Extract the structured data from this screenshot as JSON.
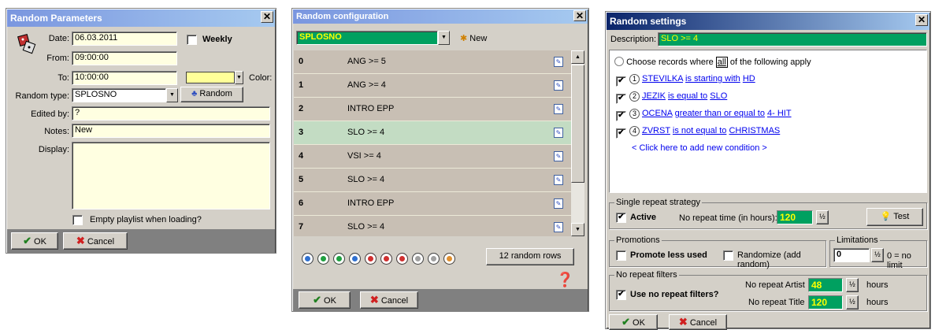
{
  "win1": {
    "title": "Random Parameters",
    "date_label": "Date:",
    "date_value": "06.03.2011",
    "weekly_label": "Weekly",
    "from_label": "From:",
    "from_value": "09:00:00",
    "to_label": "To:",
    "to_value": "10:00:00",
    "color_label": "Color:",
    "color_value": "#ffff99",
    "random_type_label": "Random type:",
    "random_type_value": "SPLOSNO",
    "random_button": "Random",
    "edited_by_label": "Edited by:",
    "edited_by_value": "?",
    "notes_label": "Notes:",
    "notes_value": "New",
    "display_label": "Display:",
    "empty_playlist_label": "Empty playlist when loading?",
    "ok": "OK",
    "cancel": "Cancel"
  },
  "win2": {
    "title": "Random configuration",
    "selected": "SPLOSNO",
    "new_label": "New",
    "rows": [
      {
        "num": "0",
        "text": "ANG >= 5"
      },
      {
        "num": "1",
        "text": "ANG >= 4"
      },
      {
        "num": "2",
        "text": "INTRO EPP"
      },
      {
        "num": "3",
        "text": "SLO >= 4"
      },
      {
        "num": "4",
        "text": "VSI >= 4"
      },
      {
        "num": "5",
        "text": "SLO >= 4"
      },
      {
        "num": "6",
        "text": "INTRO EPP"
      },
      {
        "num": "7",
        "text": "SLO >= 4"
      }
    ],
    "rows_count": "12 random rows",
    "ok": "OK",
    "cancel": "Cancel"
  },
  "win3": {
    "title": "Random settings",
    "description_label": "Description:",
    "description_value": "SLO >= 4",
    "choose_prefix": "Choose records where",
    "choose_link": "all",
    "choose_suffix": "of the following apply",
    "conditions": [
      {
        "n": "1",
        "field": "STEVILKA",
        "op": "is starting with",
        "value": "HD"
      },
      {
        "n": "2",
        "field": "JEZIK",
        "op": "is equal to",
        "value": "SLO"
      },
      {
        "n": "3",
        "field": "OCENA",
        "op": "greater than or equal to",
        "value": "4- HIT"
      },
      {
        "n": "4",
        "field": "ZVRST",
        "op": "is not equal to",
        "value": "CHRISTMAS"
      }
    ],
    "add_condition": "< Click here to add new condition >",
    "single_repeat_title": "Single repeat strategy",
    "active_label": "Active",
    "no_repeat_time_label": "No repeat time (in hours):",
    "no_repeat_time_value": "120",
    "test_button": "Test",
    "promotions_title": "Promotions",
    "promote_less_used": "Promote less used",
    "randomize_label": "Randomize (add random)",
    "limitations_title": "Limitations",
    "limitations_value": "0",
    "limitations_hint": "0 = no limit",
    "no_repeat_filters_title": "No repeat filters",
    "use_no_repeat_filters": "Use no repeat filters?",
    "no_repeat_artist_label": "No repeat Artist",
    "no_repeat_artist_value": "48",
    "no_repeat_title_label": "No repeat Title",
    "no_repeat_title_value": "120",
    "hours1": "hours",
    "hours2": "hours",
    "ok": "OK",
    "cancel": "Cancel"
  }
}
